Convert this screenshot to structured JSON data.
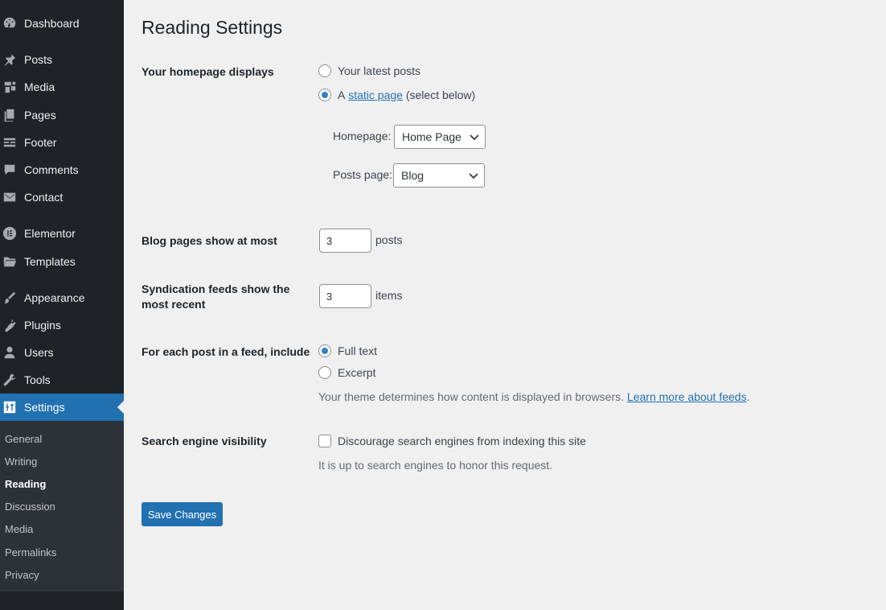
{
  "sidebar": {
    "items": [
      {
        "label": "Dashboard",
        "icon": "dashboard-icon"
      },
      {
        "label": "Posts",
        "icon": "pin-icon"
      },
      {
        "label": "Media",
        "icon": "media-icon"
      },
      {
        "label": "Pages",
        "icon": "pages-icon"
      },
      {
        "label": "Footer",
        "icon": "footer-icon"
      },
      {
        "label": "Comments",
        "icon": "comment-icon"
      },
      {
        "label": "Contact",
        "icon": "mail-icon"
      },
      {
        "label": "Elementor",
        "icon": "elementor-icon"
      },
      {
        "label": "Templates",
        "icon": "folder-icon"
      },
      {
        "label": "Appearance",
        "icon": "brush-icon"
      },
      {
        "label": "Plugins",
        "icon": "plugin-icon"
      },
      {
        "label": "Users",
        "icon": "user-icon"
      },
      {
        "label": "Tools",
        "icon": "wrench-icon"
      },
      {
        "label": "Settings",
        "icon": "settings-icon"
      }
    ],
    "submenu": [
      "General",
      "Writing",
      "Reading",
      "Discussion",
      "Media",
      "Permalinks",
      "Privacy"
    ]
  },
  "page": {
    "title": "Reading Settings",
    "homepage_displays": {
      "label": "Your homepage displays",
      "option_latest": "Your latest posts",
      "option_static_prefix": "A",
      "option_static_link": "static page",
      "option_static_suffix": "(select below)",
      "homepage_label": "Homepage:",
      "homepage_value": "Home Page",
      "posts_page_label": "Posts page:",
      "posts_page_value": "Blog"
    },
    "blog_pages": {
      "label": "Blog pages show at most",
      "value": "3",
      "unit": "posts"
    },
    "syndication": {
      "label": "Syndication feeds show the most recent",
      "value": "3",
      "unit": "items"
    },
    "feed_include": {
      "label": "For each post in a feed, include",
      "option_full": "Full text",
      "option_excerpt": "Excerpt",
      "desc_text": "Your theme determines how content is displayed in browsers.",
      "desc_link": "Learn more about feeds",
      "desc_end": "."
    },
    "search_visibility": {
      "label": "Search engine visibility",
      "checkbox_label": "Discourage search engines from indexing this site",
      "desc": "It is up to search engines to honor this request."
    },
    "save_label": "Save Changes"
  },
  "colors": {
    "sidebar": "#1d2327",
    "accent": "#2271b1",
    "background": "#f0f0f1"
  }
}
